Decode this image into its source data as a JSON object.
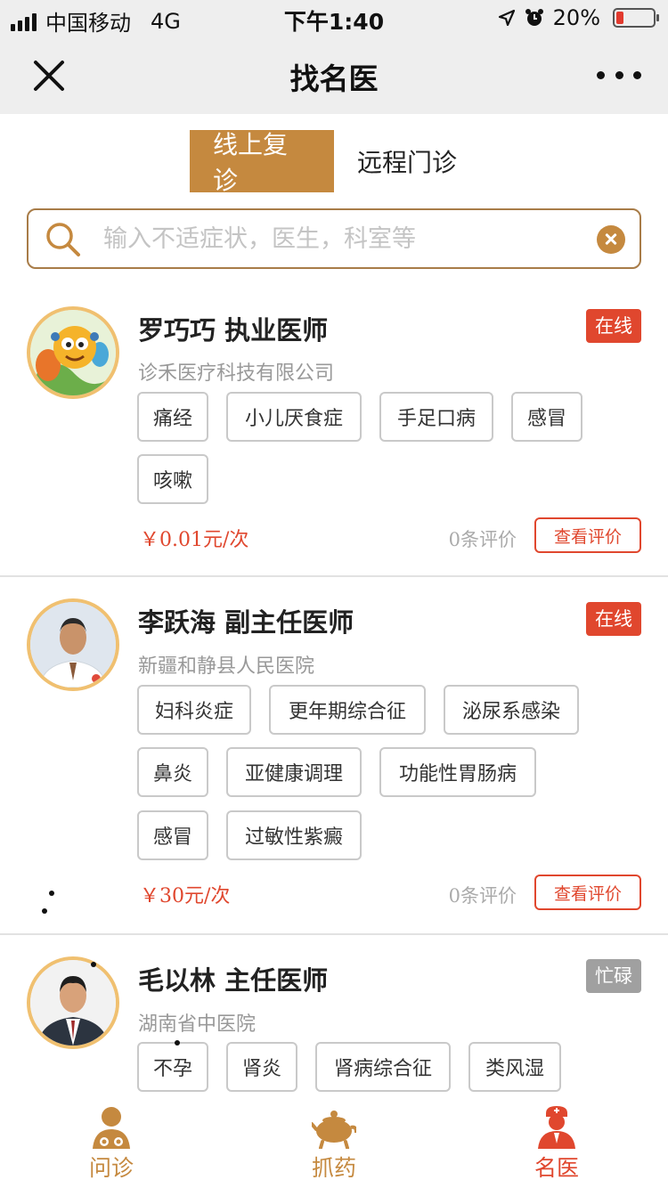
{
  "status_bar": {
    "carrier": "中国移动",
    "network": "4G",
    "time": "下午1:40",
    "battery": "20%"
  },
  "nav": {
    "title": "找名医"
  },
  "tabs": [
    {
      "label": "线上复诊",
      "active": true
    },
    {
      "label": "远程门诊",
      "active": false
    }
  ],
  "search": {
    "placeholder": "输入不适症状，医生，科室等",
    "value": ""
  },
  "doctors": [
    {
      "name": "罗巧巧 执业医师",
      "status": "在线",
      "hospital": "诊禾医疗科技有限公司",
      "tags": [
        "痛经",
        "小儿厌食症",
        "手足口病",
        "感冒",
        "咳嗽"
      ],
      "price": "￥0.01元/次",
      "reviews": "0条评价",
      "review_button": "查看评价"
    },
    {
      "name": "李跃海 副主任医师",
      "status": "在线",
      "hospital": "新疆和静县人民医院",
      "tags": [
        "妇科炎症",
        "更年期综合征",
        "泌尿系感染",
        "鼻炎",
        "亚健康调理",
        "功能性胃肠病",
        "感冒",
        "过敏性紫癜"
      ],
      "price": "￥30元/次",
      "reviews": "0条评价",
      "review_button": "查看评价"
    },
    {
      "name": "毛以林 主任医师",
      "status": "忙碌",
      "hospital": "湖南省中医院",
      "tags": [
        "不孕",
        "肾炎",
        "肾病综合征",
        "类风湿"
      ]
    }
  ],
  "bottom_tabs": [
    {
      "label": "问诊",
      "icon": "consult-icon",
      "active": false
    },
    {
      "label": "抓药",
      "icon": "herbal-medicine-icon",
      "active": false
    },
    {
      "label": "名医",
      "icon": "doctor-icon",
      "active": true
    }
  ],
  "colors": {
    "accent": "#c5893f",
    "online": "#e0472e",
    "busy": "#a0a0a0",
    "nav_bg": "#eeeeee"
  }
}
